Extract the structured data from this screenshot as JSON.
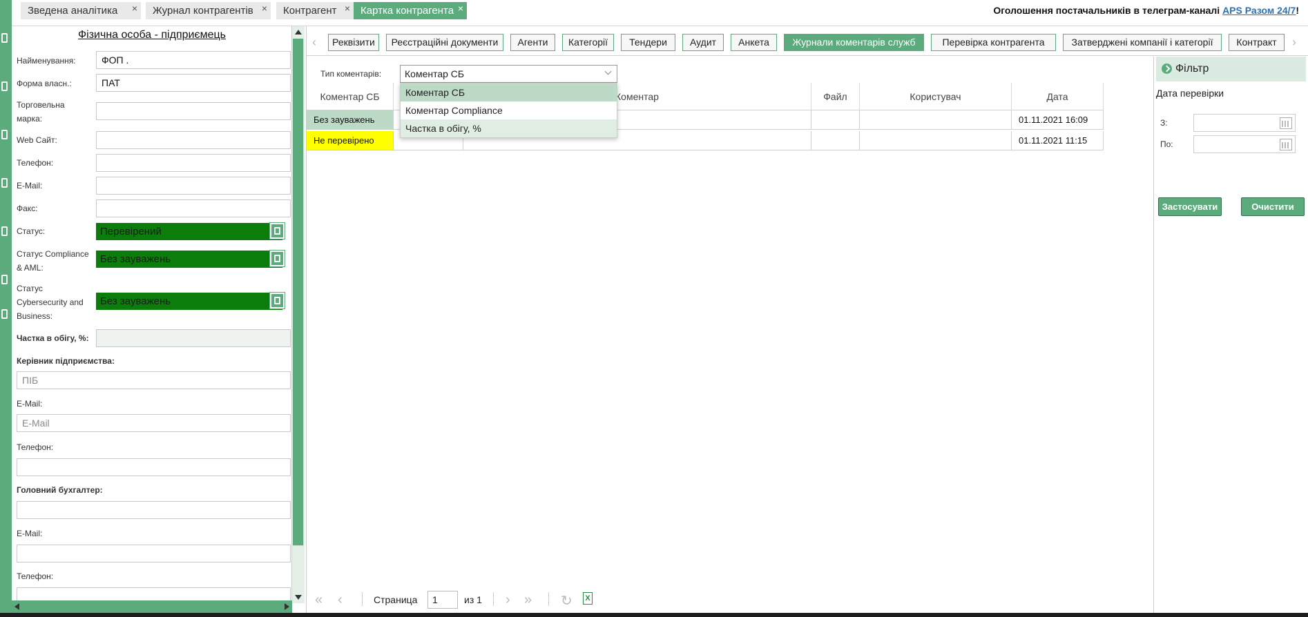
{
  "top_tabs": [
    {
      "label": "Зведена аналітика",
      "close": "×"
    },
    {
      "label": "Журнал контрагентів",
      "close": "×"
    },
    {
      "label": "Контрагент",
      "close": "×"
    },
    {
      "label": "Картка контрагента",
      "close": "×",
      "active": true
    }
  ],
  "announcement": {
    "text": "Оголошення постачальників в телеграм-каналі ",
    "link": "APS Разом 24/7",
    "suffix": "!"
  },
  "left_panel": {
    "title": "Фізична особа - підприємець",
    "fields": {
      "name_label": "Найменування:",
      "name_value": "ФОП                                 .",
      "ownership_label": "Форма власн.:",
      "ownership_value": "ПАТ",
      "trademark_label_1": "Торговельна",
      "trademark_label_2": "марка:",
      "website_label": "Web Сайт:",
      "phone_label": "Телефон:",
      "email_label": "E-Mail:",
      "fax_label": "Факс:",
      "status_label": "Статус:",
      "status_value": "Перевірений",
      "compliance_label_1": "Статус Compliance",
      "compliance_label_2": "& AML:",
      "compliance_value": "Без зауважень",
      "cyber_label_1": "Статус",
      "cyber_label_2": "Cybersecurity and",
      "cyber_label_3": "Business:",
      "cyber_value": "Без зауважень",
      "share_label": "Частка в обігу, %:",
      "director_label": "Керівник підприємства:",
      "director_placeholder": "ПІБ",
      "director_email_label": "E-Mail:",
      "director_email_placeholder": "E-Mail",
      "director_phone_label": "Телефон:",
      "accountant_label": "Головний бухгалтер:",
      "accountant_email_label": "E-Mail:",
      "accountant_phone_label": "Телефон:"
    }
  },
  "sub_tabs": [
    {
      "label": "Реквізити"
    },
    {
      "label": "Реєстраційні документи"
    },
    {
      "label": "Агенти"
    },
    {
      "label": "Категорії"
    },
    {
      "label": "Тендери"
    },
    {
      "label": "Аудит"
    },
    {
      "label": "Анкета"
    },
    {
      "label": "Журнали коментарів служб",
      "active": true
    },
    {
      "label": "Перевірка контрагента"
    },
    {
      "label": "Затверджені компанії і категорії"
    },
    {
      "label": "Контракт"
    }
  ],
  "comment_type": {
    "label": "Тип коментарів:",
    "value": "Коментар СБ",
    "options": [
      "Коментар СБ",
      "Коментар Compliance",
      "Частка в обігу, %"
    ]
  },
  "table": {
    "columns": [
      "Коментар СБ",
      "Коментар",
      "Файл",
      "Користувач",
      "Дата"
    ],
    "rows": [
      {
        "sb": "Без зауважень",
        "comment": "",
        "file": "",
        "user": "",
        "date": "01.11.2021 16:09"
      },
      {
        "sb": "Не перевірено",
        "comment": "",
        "file": "",
        "user": "",
        "date": "01.11.2021 11:15"
      }
    ]
  },
  "pager": {
    "page_label": "Страница",
    "page_value": "1",
    "of_label": "из 1"
  },
  "filter": {
    "title": "Фільтр",
    "date_label": "Дата перевірки",
    "from_label": "З:",
    "to_label": "По:",
    "apply_label": "Застосувати",
    "clear_label": "Очистити"
  },
  "colors": {
    "accent": "#5cab7d",
    "status_green": "#0a7d0a",
    "warn_yellow": "#ffff00",
    "selected_row": "#bcdac6"
  }
}
